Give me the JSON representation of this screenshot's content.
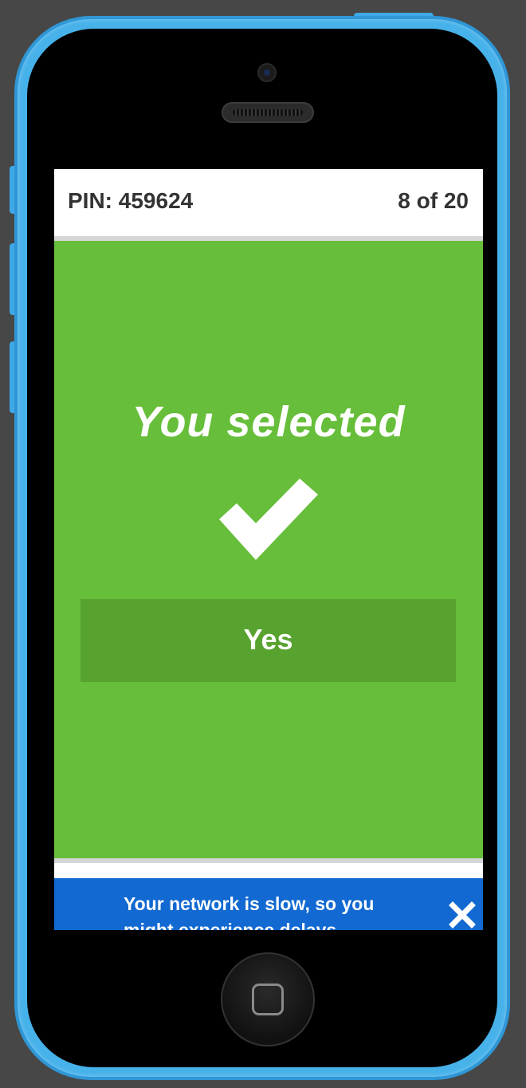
{
  "header": {
    "pin_text": "PIN: 459624",
    "progress_text": "8 of 20"
  },
  "result": {
    "heading": "You selected",
    "icon": "checkmark-icon",
    "answer_label": "Yes"
  },
  "notification": {
    "message": "Your network is slow, so you might experience delays.",
    "close_icon": "close-icon"
  },
  "colors": {
    "background": "#474747",
    "device_frame": "#47b2ea",
    "content_green": "#66be3a",
    "answer_green": "#58a32f",
    "toast_blue": "#1169d1",
    "text_dark": "#333333"
  }
}
